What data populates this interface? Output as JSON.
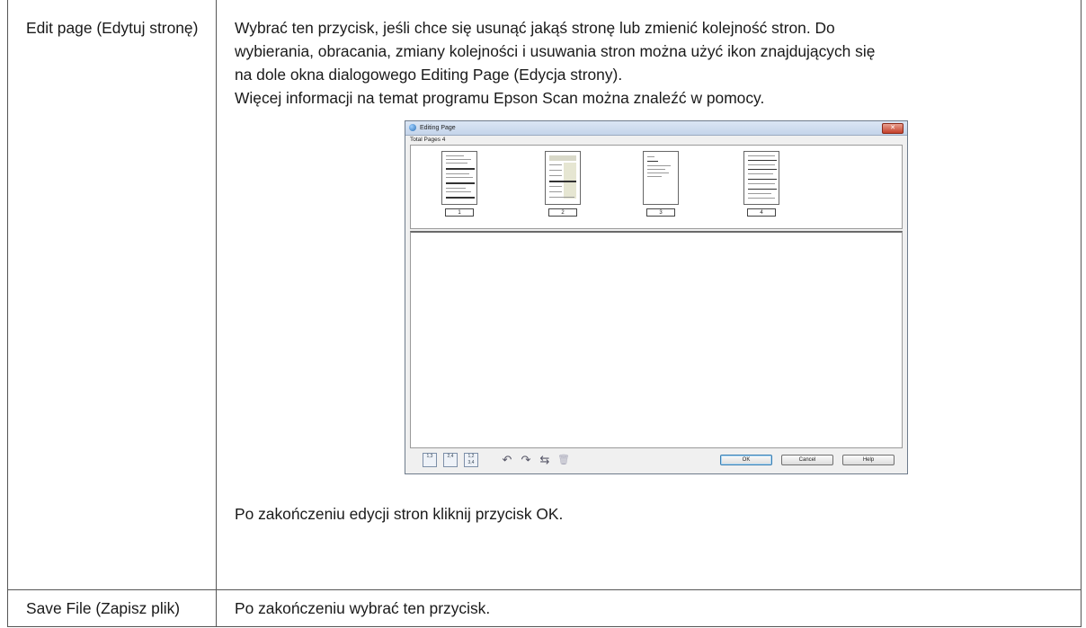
{
  "rows": [
    {
      "label": "Edit page (Edytuj stronę)",
      "description": [
        "Wybrać ten przycisk, jeśli chce się usunąć jakąś stronę lub zmienić kolejność stron. Do",
        "wybierania, obracania, zmiany kolejności i usuwania stron można użyć ikon znajdujących się",
        "na dole okna dialogowego Editing Page (Edycja strony).",
        "Więcej informacji na temat programu Epson Scan można znaleźć w pomocy."
      ],
      "closing": "Po zakończeniu edycji stron kliknij przycisk OK."
    },
    {
      "label": "Save File (Zapisz plik)",
      "description": [
        "Po zakończeniu wybrać ten przycisk."
      ]
    }
  ],
  "dialog": {
    "title": "Editing Page",
    "close_glyph": "✕",
    "total_pages_label": "Total Pages 4",
    "pages": [
      "1",
      "2",
      "3",
      "4"
    ],
    "tool_buttons": [
      {
        "icon": "select-odd-pages-icon",
        "label": "1,3"
      },
      {
        "icon": "select-even-pages-icon",
        "label": "2,4"
      },
      {
        "icon": "select-all-pages-icon",
        "label": "1,2 3,4"
      }
    ],
    "action_icons": [
      {
        "icon": "rotate-left-icon",
        "glyph": "↶"
      },
      {
        "icon": "rotate-right-icon",
        "glyph": "↷"
      },
      {
        "icon": "reorder-icon",
        "glyph": "⇆"
      },
      {
        "icon": "delete-icon",
        "glyph": "🗑"
      }
    ],
    "buttons": {
      "ok": "OK",
      "cancel": "Cancel",
      "help": "Help"
    }
  }
}
